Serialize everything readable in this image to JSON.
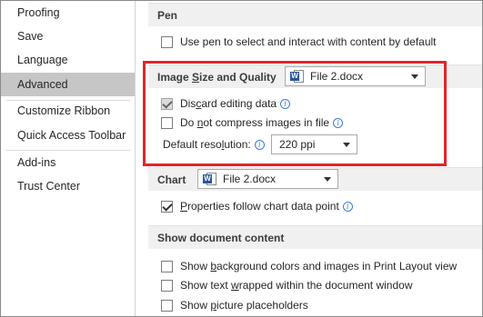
{
  "sidebar": {
    "items": [
      {
        "label": "Proofing"
      },
      {
        "label": "Save"
      },
      {
        "label": "Language"
      },
      {
        "label": "Advanced"
      },
      {
        "label": "Customize Ribbon"
      },
      {
        "label": "Quick Access Toolbar"
      },
      {
        "label": "Add-ins"
      },
      {
        "label": "Trust Center"
      }
    ],
    "active": "Advanced"
  },
  "pen": {
    "title": "Pen",
    "use_pen_label": "Use pen to select and interact with content by default",
    "use_pen_checked": false
  },
  "image_size": {
    "title_pre": "Image ",
    "title_u": "S",
    "title_post": "ize and Quality",
    "file_dropdown_value": "File 2.docx",
    "discard_pre": "Dis",
    "discard_u": "c",
    "discard_post": "ard editing data",
    "discard_checked": true,
    "no_compress_pre": "Do ",
    "no_compress_u": "n",
    "no_compress_post": "ot compress images in file",
    "no_compress_checked": false,
    "resolution_pre": "Default reso",
    "resolution_u": "l",
    "resolution_post": "ution:",
    "resolution_value": "220 ppi"
  },
  "chart": {
    "title": "Chart",
    "file_dropdown_value": "File 2.docx",
    "follow_pre": "",
    "follow_u": "P",
    "follow_post": "roperties follow chart data point",
    "follow_checked": true
  },
  "show_doc": {
    "title": "Show document content",
    "bg_pre": "Show ",
    "bg_u": "b",
    "bg_post": "ackground colors and images in Print Layout view",
    "wrap_pre": "Show text ",
    "wrap_u": "w",
    "wrap_post": "rapped within the document window",
    "pic_pre": "Show ",
    "pic_u": "p",
    "pic_post": "icture placeholders"
  },
  "info_glyph": "i",
  "word_glyph": "W",
  "colors": {
    "highlight": "#e0252b",
    "active_nav": "#c6c6c6",
    "word_blue": "#2b579a"
  }
}
